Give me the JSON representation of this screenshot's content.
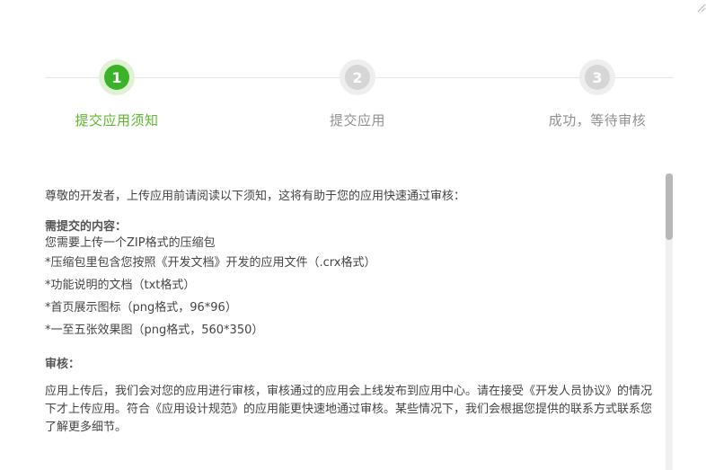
{
  "colors": {
    "accent_green": "#3cb22a",
    "accent_label": "#5cb82c",
    "inactive": "#d6d6d6",
    "inactive_label": "#909090",
    "text": "#444444"
  },
  "steps": [
    {
      "number": "1",
      "label": "提交应用须知",
      "state": "active"
    },
    {
      "number": "2",
      "label": "提交应用",
      "state": "inactive"
    },
    {
      "number": "3",
      "label": "成功，等待审核",
      "state": "inactive"
    }
  ],
  "content": {
    "intro": "尊敬的开发者，上传应用前请阅读以下须知，这将有助于您的应用快速通过审核：",
    "requirements_title": "需提交的内容：",
    "requirements_items": [
      "您需要上传一个ZIP格式的压缩包",
      "*压缩包里包含您按照《开发文档》开发的应用文件（.crx格式）",
      "*功能说明的文档（txt格式）",
      "*首页展示图标（png格式，96*96）",
      "*一至五张效果图（png格式，560*350）"
    ],
    "review_title": "审核：",
    "review_text": "应用上传后，我们会对您的应用进行审核，审核通过的应用会上线发布到应用中心。请在接受《开发人员协议》的情况下才上传应用。符合《应用设计规范》的应用能更快速地通过审核。某些情况下，我们会根据您提供的联系方式联系您了解更多细节。"
  },
  "icons": {
    "corner": "resize-corner-icon"
  }
}
